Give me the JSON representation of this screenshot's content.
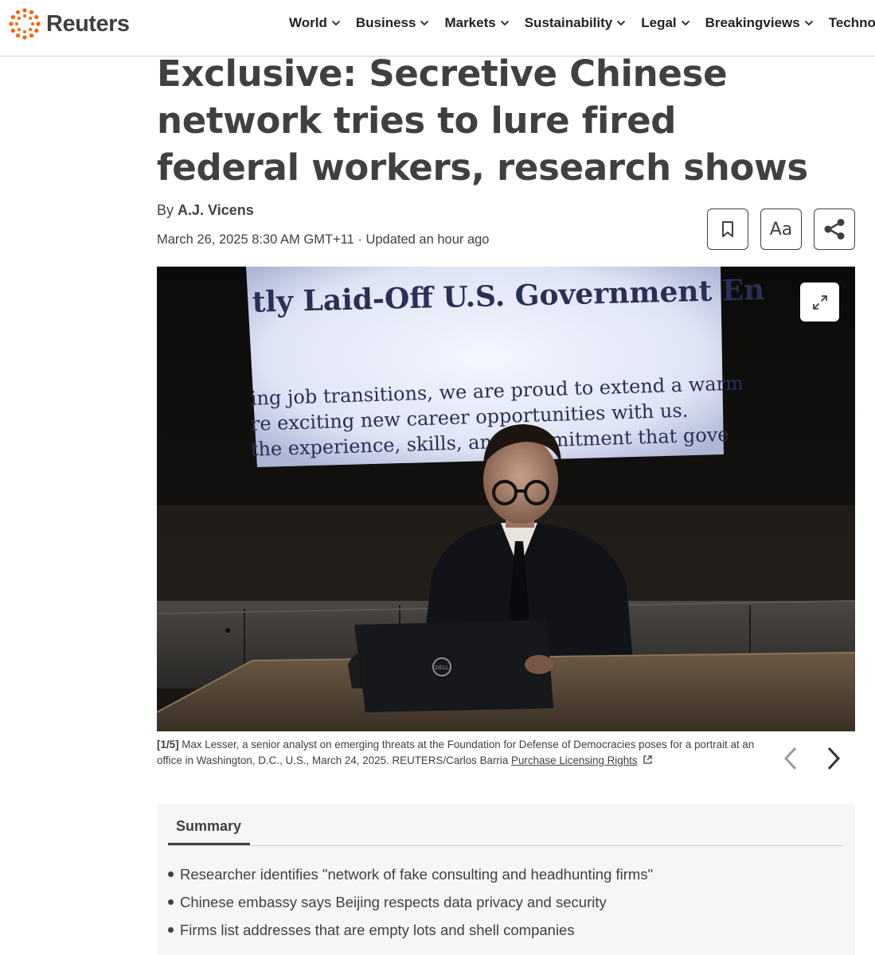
{
  "header": {
    "brand": "Reuters",
    "nav": [
      {
        "label": "World"
      },
      {
        "label": "Business"
      },
      {
        "label": "Markets"
      },
      {
        "label": "Sustainability"
      },
      {
        "label": "Legal"
      },
      {
        "label": "Breakingviews"
      },
      {
        "label": "Technology"
      }
    ]
  },
  "article": {
    "headline": "Exclusive: Secretive Chinese network tries to lure fired federal workers, research shows",
    "byline_prefix": "By ",
    "author": "A.J. Vicens",
    "dateline": "March 26, 2025 8:30 AM GMT+11 · Updated an hour ago",
    "tools": {
      "font_size_label": "Aa"
    }
  },
  "photo": {
    "screen_text_lines": [
      "tly Laid-Off U.S. Government En",
      "ing job transitions, we are proud to extend a warm",
      "re exciting new career opportunities with us.",
      " the experience, skills, and commitment that gove"
    ],
    "laptop_logo": "DELL"
  },
  "caption": {
    "counter": "[1/5]",
    "text": " Max Lesser, a senior analyst on emerging threats at the Foundation for Defense of Democracies poses for a portrait at an office in Washington, D.C., U.S., March 24, 2025. REUTERS/Carlos Barria ",
    "licensing": "Purchase Licensing Rights"
  },
  "summary": {
    "tab_label": "Summary",
    "items": [
      "Researcher identifies \"network of fake consulting and headhunting firms\"",
      "Chinese embassy says Beijing respects data privacy and security",
      "Firms list addresses that are empty lots and shell companies"
    ]
  },
  "colors": {
    "brand_orange": "#fa6400",
    "text": "#404040",
    "summary_bg": "#f6f6f6"
  }
}
